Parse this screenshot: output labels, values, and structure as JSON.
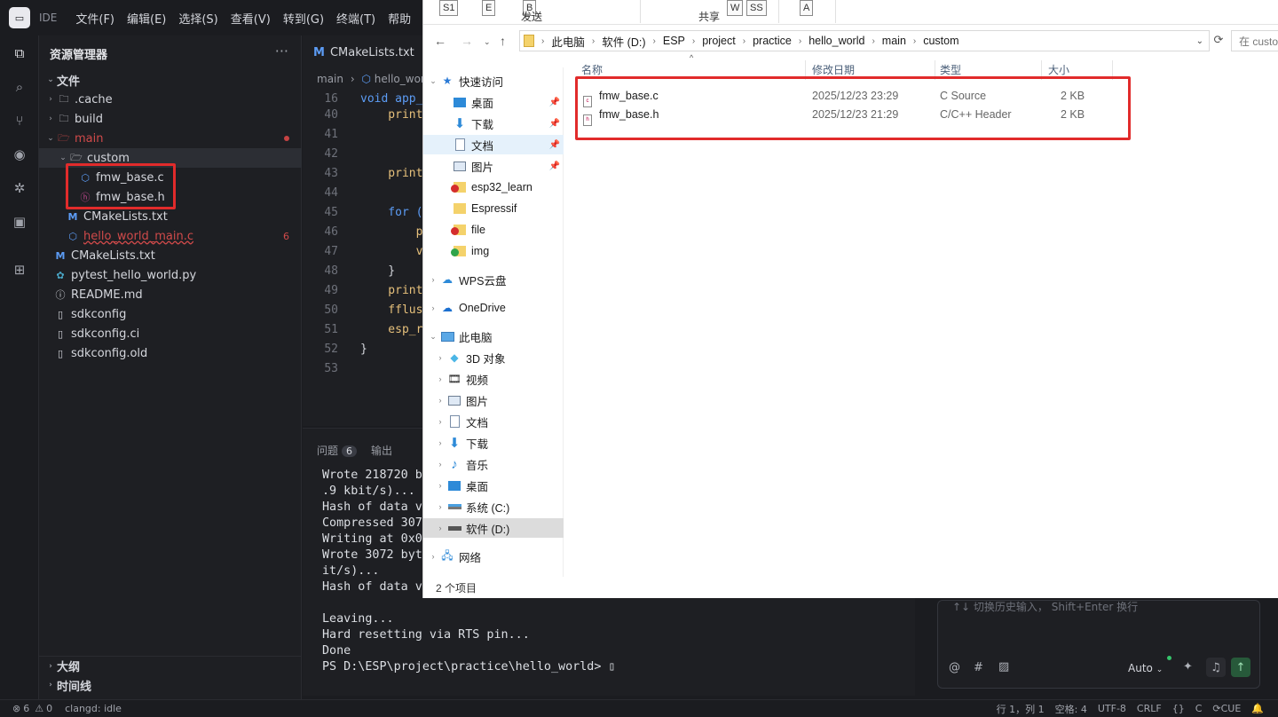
{
  "menubar": {
    "ide_label": "IDE",
    "items": [
      "文件(F)",
      "编辑(E)",
      "选择(S)",
      "查看(V)",
      "转到(G)",
      "终端(T)",
      "帮助"
    ]
  },
  "explorer": {
    "title": "资源管理器",
    "more": "···",
    "section": "文件",
    "items": [
      ".cache",
      "build",
      "main",
      "custom",
      "fmw_base.c",
      "fmw_base.h",
      "CMakeLists.txt",
      "hello_world_main.c",
      "CMakeLists.txt",
      "pytest_hello_world.py",
      "README.md",
      "sdkconfig",
      "sdkconfig.ci",
      "sdkconfig.old"
    ],
    "error_count": "6",
    "outline": "大纲",
    "timeline": "时间线"
  },
  "editor": {
    "tab": "CMakeLists.txt",
    "breadcrumb": [
      "main",
      "hello_worl"
    ],
    "lines": [
      {
        "n": "16",
        "t": "void app_"
      },
      {
        "n": "40",
        "t": "    print"
      },
      {
        "n": "41",
        "t": ""
      },
      {
        "n": "42",
        "t": ""
      },
      {
        "n": "43",
        "t": "    print"
      },
      {
        "n": "44",
        "t": ""
      },
      {
        "n": "45",
        "t": "    for ("
      },
      {
        "n": "46",
        "t": "        p"
      },
      {
        "n": "47",
        "t": "        v"
      },
      {
        "n": "48",
        "t": "    }"
      },
      {
        "n": "49",
        "t": "    print"
      },
      {
        "n": "50",
        "t": "    fflus"
      },
      {
        "n": "51",
        "t": "    esp_r"
      },
      {
        "n": "52",
        "t": "}"
      },
      {
        "n": "53",
        "t": ""
      }
    ]
  },
  "panel": {
    "tab_problems": "问题",
    "problems_count": "6",
    "tab_output": "输出",
    "terminal": "Wrote 218720 b\n.9 kbit/s)...\nHash of data v\nCompressed 307\nWriting at 0x0\nWrote 3072 byt\nit/s)...\nHash of data v\n\nLeaving...\nHard resetting via RTS pin...\nDone\nPS D:\\ESP\\project\\practice\\hello_world> ▯"
  },
  "chat": {
    "placeholder": "↑↓ 切换历史输入，  Shift+Enter  换行",
    "mode": "Auto"
  },
  "status": {
    "errors": "6",
    "warnings": "0",
    "lsp": "clangd: idle",
    "position": "行 1，列 1",
    "spaces": "空格: 4",
    "encoding": "UTF-8",
    "eol": "CRLF",
    "braces": "{}",
    "lang": "C",
    "cue": "CUE"
  },
  "window": {
    "ribbon": {
      "keys": [
        "S1",
        "E",
        "B",
        "W",
        "SS",
        "A"
      ],
      "send": "发送",
      "share": "共享"
    },
    "path": [
      "此电脑",
      "软件 (D:)",
      "ESP",
      "project",
      "practice",
      "hello_world",
      "main",
      "custom"
    ],
    "search_placeholder": "在 custom",
    "columns": {
      "name": "名称",
      "date": "修改日期",
      "type": "类型",
      "size": "大小"
    },
    "files": [
      {
        "name": "fmw_base.c",
        "date": "2025/12/23 23:29",
        "type": "C Source",
        "size": "2 KB"
      },
      {
        "name": "fmw_base.h",
        "date": "2025/12/23 21:29",
        "type": "C/C++ Header",
        "size": "2 KB"
      }
    ],
    "nav": {
      "quick_access": "快速访问",
      "quick_items": [
        "桌面",
        "下载",
        "文档",
        "图片",
        "esp32_learn",
        "Espressif",
        "file",
        "img"
      ],
      "wps": "WPS云盘",
      "onedrive": "OneDrive",
      "this_pc": "此电脑",
      "pc_items": [
        "3D 对象",
        "视频",
        "图片",
        "文档",
        "下载",
        "音乐",
        "桌面",
        "系统 (C:)",
        "软件 (D:)"
      ],
      "network": "网络"
    },
    "item_count": "2 个项目"
  }
}
